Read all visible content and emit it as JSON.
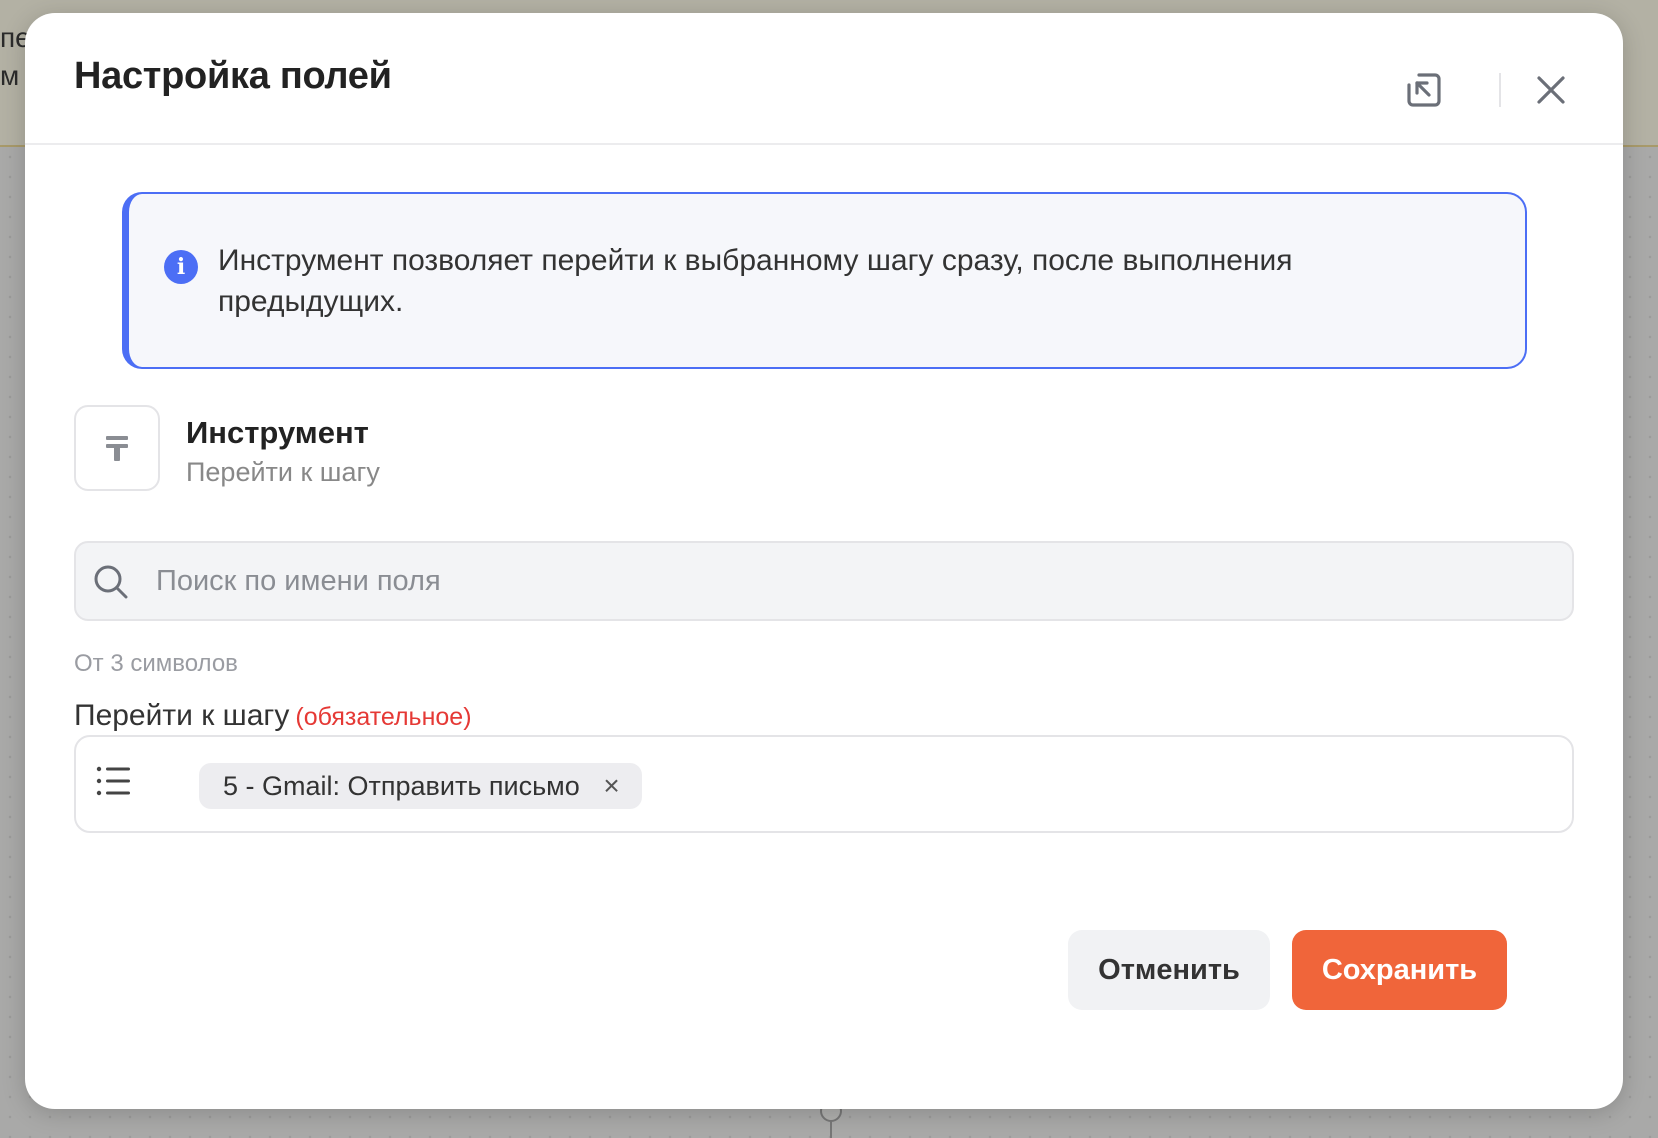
{
  "background": {
    "partial_text_top": "пе",
    "partial_text_bottom": "м"
  },
  "modal": {
    "title": "Настройка полей",
    "icons": {
      "collapse": "arrow-collapse-icon",
      "close": "close-icon"
    }
  },
  "info": {
    "icon": "info-icon",
    "text": "Инструмент позволяет перейти к выбранному шагу сразу, после выполнения предыдущих."
  },
  "tool": {
    "icon": "text-tool-icon",
    "title": "Инструмент",
    "subtitle": "Перейти к шагу"
  },
  "search": {
    "placeholder": "Поиск по имени поля",
    "value": "",
    "hint": "От 3 символов"
  },
  "field": {
    "label": "Перейти к шагу",
    "required_text": "(обязательное)",
    "selected_chip": "5 - Gmail: Отправить письмо",
    "chip_remove": "×"
  },
  "buttons": {
    "cancel": "Отменить",
    "save": "Сохранить"
  },
  "colors": {
    "accent": "#4c6ef5",
    "primary_button": "#f0653a",
    "required": "#e53935"
  }
}
